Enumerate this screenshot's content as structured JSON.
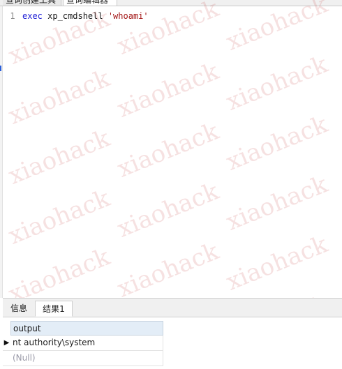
{
  "top_tabs": [
    {
      "label": "查询创建工具"
    },
    {
      "label": "查询编辑器"
    }
  ],
  "editor": {
    "line_number": "1",
    "code_keyword": "exec",
    "code_identifier": " xp_cmdshell ",
    "code_string": "'whoami'"
  },
  "watermark": {
    "text": "xiaohack",
    "color": "#c94b4b"
  },
  "result_tabs": [
    {
      "label": "信息"
    },
    {
      "label": "结果1"
    }
  ],
  "grid": {
    "header": "output",
    "current_row_icon": "row-pointer-icon",
    "rows": [
      {
        "value": "nt authority\\system"
      },
      {
        "value": "(Null)"
      }
    ]
  },
  "colors": {
    "keyword": "#1f1fd6",
    "string": "#a31515",
    "header_bg": "#e3edf7"
  }
}
